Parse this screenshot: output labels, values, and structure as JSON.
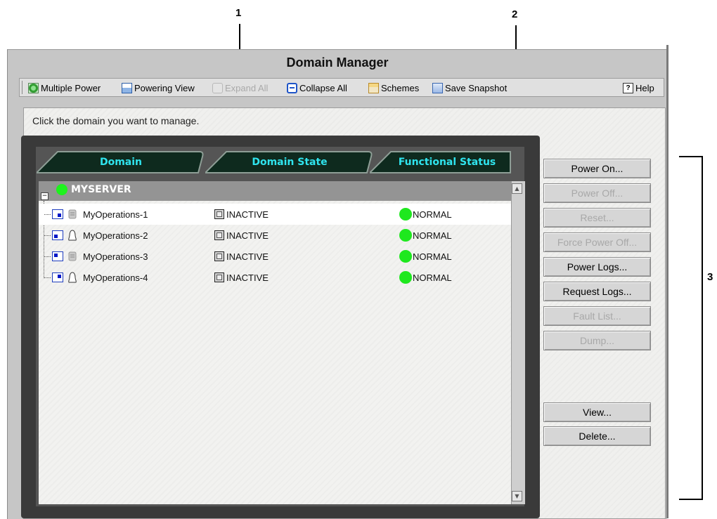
{
  "callouts": {
    "c1": "1",
    "c2": "2",
    "c3": "3"
  },
  "window": {
    "title": "Domain Manager"
  },
  "toolbar": {
    "multiple_power": "Multiple Power",
    "powering_view": "Powering View",
    "expand_all": "Expand All",
    "collapse_all": "Collapse All",
    "schemes": "Schemes",
    "save_snapshot": "Save Snapshot",
    "help": "Help"
  },
  "content": {
    "instruction": "Click the domain you want to manage."
  },
  "table": {
    "columns": [
      "Domain",
      "Domain State",
      "Functional Status"
    ],
    "group": {
      "name": "MYSERVER",
      "status_color": "#1df21d"
    },
    "rows": [
      {
        "name": "MyOperations-1",
        "state": "INACTIVE",
        "status": "NORMAL"
      },
      {
        "name": "MyOperations-2",
        "state": "INACTIVE",
        "status": "NORMAL"
      },
      {
        "name": "MyOperations-3",
        "state": "INACTIVE",
        "status": "NORMAL"
      },
      {
        "name": "MyOperations-4",
        "state": "INACTIVE",
        "status": "NORMAL"
      }
    ]
  },
  "actions": {
    "power_on": "Power On...",
    "power_off": "Power Off...",
    "reset": "Reset...",
    "force_power_off": "Force Power Off...",
    "power_logs": "Power Logs...",
    "request_logs": "Request Logs...",
    "fault_list": "Fault List...",
    "dump": "Dump...",
    "view": "View...",
    "delete": "Delete..."
  },
  "colors": {
    "header_text": "#2fe4ee",
    "status_green": "#1ee81e",
    "panel_dark": "#3a3a3a"
  }
}
